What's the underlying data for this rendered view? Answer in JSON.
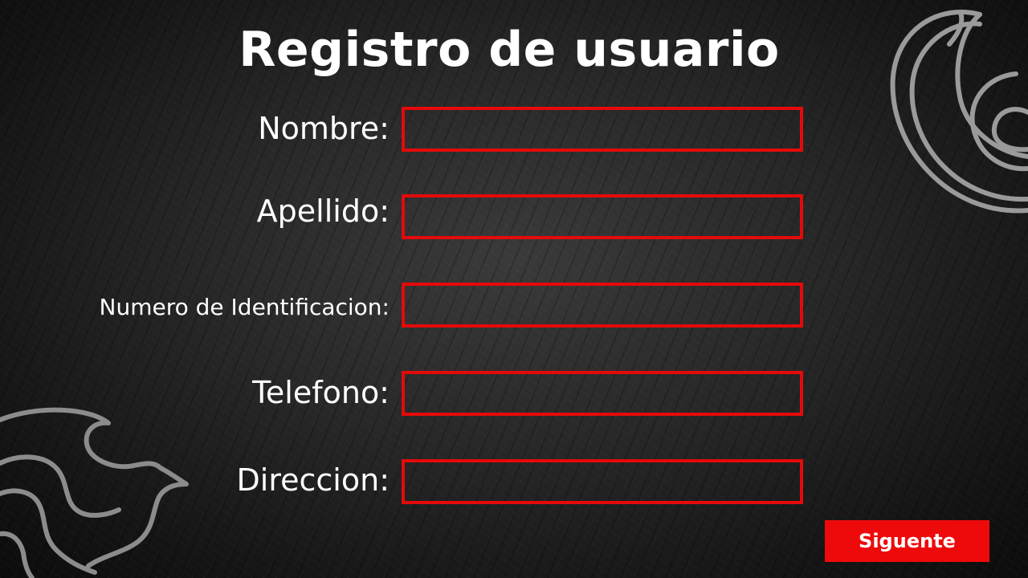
{
  "title": "Registro de usuario",
  "fields": [
    {
      "label": "Nombre:",
      "value": "",
      "placeholder": ""
    },
    {
      "label": "Apellido:",
      "value": "",
      "placeholder": ""
    },
    {
      "label": "Numero de Identificacion:",
      "value": "",
      "placeholder": ""
    },
    {
      "label": "Telefono:",
      "value": "",
      "placeholder": ""
    },
    {
      "label": "Direccion:",
      "value": "",
      "placeholder": ""
    }
  ],
  "next_button": {
    "label": "Siguente"
  },
  "colors": {
    "background": "#222222",
    "field_border": "#e50a0a",
    "button": "#ee0a0a",
    "text": "#ffffff",
    "ornament": "#9a9a9a"
  },
  "icons": [
    "swirl-ornament-icon",
    "flame-ornament-icon"
  ]
}
